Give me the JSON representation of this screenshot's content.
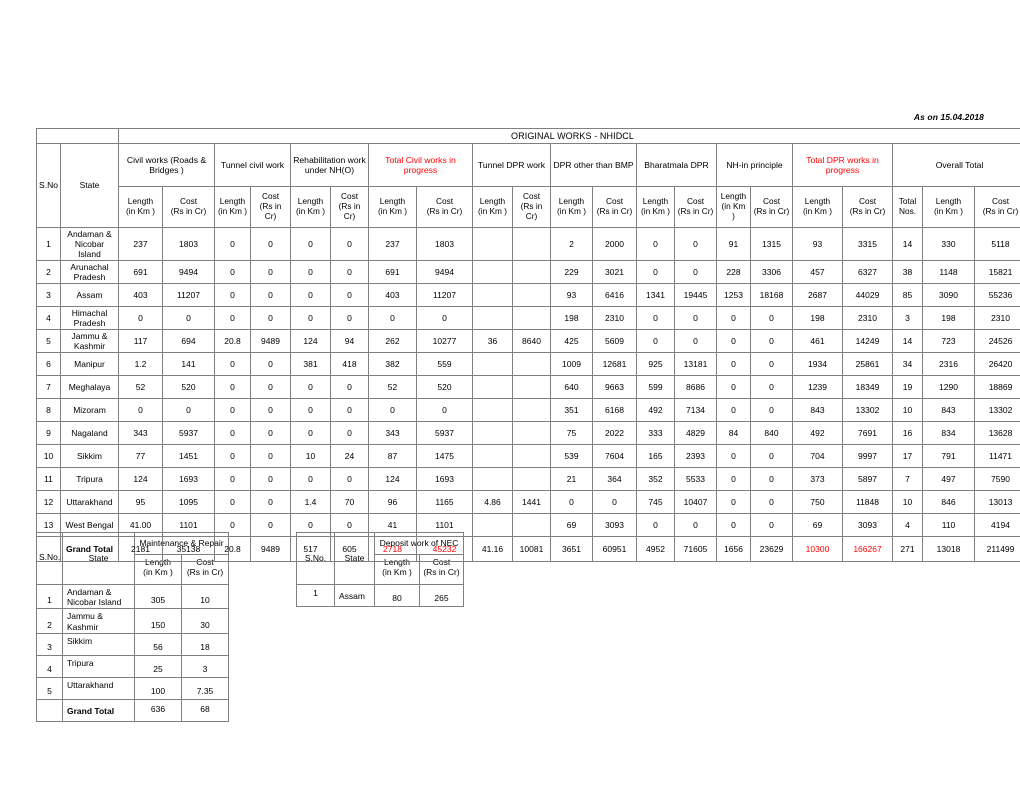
{
  "as_on": "As on 15.04.2018",
  "main_table": {
    "title": "ORIGINAL WORKS - NHIDCL",
    "sno_header": "S.No",
    "state_header": "State",
    "groups": [
      {
        "label": "Civil works (Roads & Bridges )",
        "red": false
      },
      {
        "label": "Tunnel civil work",
        "red": false
      },
      {
        "label": "Rehabilitation work under NH(O)",
        "red": false
      },
      {
        "label": "Total Civil works in progress",
        "red": true
      },
      {
        "label": "Tunnel DPR work",
        "red": false
      },
      {
        "label": "DPR other than BMP",
        "red": false
      },
      {
        "label": "Bharatmala DPR",
        "red": false
      },
      {
        "label": "NH-in principle",
        "red": false
      },
      {
        "label": "Total DPR  works in progress",
        "red": true
      },
      {
        "label": "Overall  Total",
        "red": false
      }
    ],
    "sub_headers": [
      "Length (in Km )",
      "Cost (Rs in Cr)",
      "Length (in Km )",
      "Cost (Rs in Cr)",
      "Length (in Km )",
      "Cost (Rs in Cr)",
      "Length (in Km )",
      "Cost (Rs in Cr)",
      "Length (in Km )",
      "Cost (Rs in Cr)",
      "Length (in Km )",
      "Cost (Rs in Cr)",
      "Length (in Km )",
      "Cost (Rs in Cr)",
      "Length (in Km )",
      "Cost (Rs in Cr)",
      "Length (in Km )",
      "Cost (Rs in Cr)",
      "Total Nos.",
      "Length (in Km )",
      "Cost (Rs in Cr)"
    ],
    "sub_header_parts": [
      {
        "l1": "Length",
        "l2": "(in Km )"
      },
      {
        "l1": "Cost",
        "l2": "(Rs in Cr)"
      },
      {
        "l1": "Length",
        "l2": "(in Km )"
      },
      {
        "l1": "Cost",
        "l2": "(Rs in Cr)"
      },
      {
        "l1": "Length",
        "l2": "(in Km )"
      },
      {
        "l1": "Cost",
        "l2": "(Rs in Cr)"
      },
      {
        "l1": "Length",
        "l2": "(in Km )"
      },
      {
        "l1": "Cost",
        "l2": "(Rs in Cr)"
      },
      {
        "l1": "Length",
        "l2": "(in Km )"
      },
      {
        "l1": "Cost",
        "l2": "(Rs in Cr)"
      },
      {
        "l1": "Length",
        "l2": "(in Km )"
      },
      {
        "l1": "Cost",
        "l2": "(Rs in Cr)"
      },
      {
        "l1": "Length",
        "l2": "(in Km )"
      },
      {
        "l1": "Cost",
        "l2": "(Rs in Cr)"
      },
      {
        "l1": "Length",
        "l2": "(in Km )"
      },
      {
        "l1": "Cost",
        "l2": "(Rs in Cr)"
      },
      {
        "l1": "Length",
        "l2": "(in Km )"
      },
      {
        "l1": "Cost",
        "l2": "(Rs in Cr)"
      },
      {
        "l1": "Total",
        "l2": "Nos."
      },
      {
        "l1": "Length",
        "l2": "(in Km )"
      },
      {
        "l1": "Cost",
        "l2": "(Rs in Cr)"
      }
    ],
    "rows": [
      {
        "sno": "1",
        "state": "Andaman & Nicobar Island",
        "v": [
          "237",
          "1803",
          "0",
          "0",
          "0",
          "0",
          "237",
          "1803",
          "",
          "",
          "2",
          "2000",
          "0",
          "0",
          "91",
          "1315",
          "93",
          "3315",
          "14",
          "330",
          "5118"
        ]
      },
      {
        "sno": "2",
        "state": "Arunachal Pradesh",
        "v": [
          "691",
          "9494",
          "0",
          "0",
          "0",
          "0",
          "691",
          "9494",
          "",
          "",
          "229",
          "3021",
          "0",
          "0",
          "228",
          "3306",
          "457",
          "6327",
          "38",
          "1148",
          "15821"
        ]
      },
      {
        "sno": "3",
        "state": "Assam",
        "v": [
          "403",
          "11207",
          "0",
          "0",
          "0",
          "0",
          "403",
          "11207",
          "",
          "",
          "93",
          "6416",
          "1341",
          "19445",
          "1253",
          "18168",
          "2687",
          "44029",
          "85",
          "3090",
          "55236"
        ]
      },
      {
        "sno": "4",
        "state": "Himachal Pradesh",
        "v": [
          "0",
          "0",
          "0",
          "0",
          "0",
          "0",
          "0",
          "0",
          "",
          "",
          "198",
          "2310",
          "0",
          "0",
          "0",
          "0",
          "198",
          "2310",
          "3",
          "198",
          "2310"
        ]
      },
      {
        "sno": "5",
        "state": "Jammu & Kashmir",
        "v": [
          "117",
          "694",
          "20.8",
          "9489",
          "124",
          "94",
          "262",
          "10277",
          "36",
          "8640",
          "425",
          "5609",
          "0",
          "0",
          "0",
          "0",
          "461",
          "14249",
          "14",
          "723",
          "24526"
        ]
      },
      {
        "sno": "6",
        "state": "Manipur",
        "v": [
          "1.2",
          "141",
          "0",
          "0",
          "381",
          "418",
          "382",
          "559",
          "",
          "",
          "1009",
          "12681",
          "925",
          "13181",
          "0",
          "0",
          "1934",
          "25861",
          "34",
          "2316",
          "26420"
        ]
      },
      {
        "sno": "7",
        "state": "Meghalaya",
        "v": [
          "52",
          "520",
          "0",
          "0",
          "0",
          "0",
          "52",
          "520",
          "",
          "",
          "640",
          "9663",
          "599",
          "8686",
          "0",
          "0",
          "1239",
          "18349",
          "19",
          "1290",
          "18869"
        ]
      },
      {
        "sno": "8",
        "state": "Mizoram",
        "v": [
          "0",
          "0",
          "0",
          "0",
          "0",
          "0",
          "0",
          "0",
          "",
          "",
          "351",
          "6168",
          "492",
          "7134",
          "0",
          "0",
          "843",
          "13302",
          "10",
          "843",
          "13302"
        ]
      },
      {
        "sno": "9",
        "state": "Nagaland",
        "v": [
          "343",
          "5937",
          "0",
          "0",
          "0",
          "0",
          "343",
          "5937",
          "",
          "",
          "75",
          "2022",
          "333",
          "4829",
          "84",
          "840",
          "492",
          "7691",
          "16",
          "834",
          "13628"
        ]
      },
      {
        "sno": "10",
        "state": "Sikkim",
        "v": [
          "77",
          "1451",
          "0",
          "0",
          "10",
          "24",
          "87",
          "1475",
          "",
          "",
          "539",
          "7604",
          "165",
          "2393",
          "0",
          "0",
          "704",
          "9997",
          "17",
          "791",
          "11471"
        ]
      },
      {
        "sno": "11",
        "state": "Tripura",
        "v": [
          "124",
          "1693",
          "0",
          "0",
          "0",
          "0",
          "124",
          "1693",
          "",
          "",
          "21",
          "364",
          "352",
          "5533",
          "0",
          "0",
          "373",
          "5897",
          "7",
          "497",
          "7590"
        ]
      },
      {
        "sno": "12",
        "state": "Uttarakhand",
        "v": [
          "95",
          "1095",
          "0",
          "0",
          "1.4",
          "70",
          "96",
          "1165",
          "4.86",
          "1441",
          "0",
          "0",
          "745",
          "10407",
          "0",
          "0",
          "750",
          "11848",
          "10",
          "846",
          "13013"
        ]
      },
      {
        "sno": "13",
        "state": "West Bengal",
        "v": [
          "41.00",
          "1101",
          "0",
          "0",
          "0",
          "0",
          "41",
          "1101",
          "",
          "",
          "69",
          "3093",
          "0",
          "0",
          "0",
          "0",
          "69",
          "3093",
          "4",
          "110",
          "4194"
        ]
      }
    ],
    "total_row": {
      "sno": "",
      "state": "Grand Total",
      "v": [
        "2181",
        "35138",
        "20.8",
        "9489",
        "517",
        "605",
        "2718",
        "45232",
        "41.16",
        "10081",
        "3651",
        "60951",
        "4952",
        "71605",
        "1656",
        "23629",
        "10300",
        "166267",
        "271",
        "13018",
        "211499"
      ],
      "red_indices": [
        6,
        7,
        16,
        17
      ]
    }
  },
  "maintenance_table": {
    "group_label": "Maintenance & Repair",
    "sno_header": "S.No.",
    "state_header": "State",
    "sub_headers": [
      {
        "l1": "Length",
        "l2": "(in Km )"
      },
      {
        "l1": "Cost",
        "l2": "(Rs in Cr)"
      }
    ],
    "rows": [
      {
        "sno": "1",
        "state": "Andaman & Nicobar Island",
        "length": "305",
        "cost": "10"
      },
      {
        "sno": "2",
        "state": "Jammu & Kashmir",
        "length": "150",
        "cost": "30"
      },
      {
        "sno": "3",
        "state": "Sikkim",
        "length": "56",
        "cost": "18"
      },
      {
        "sno": "4",
        "state": "Tripura",
        "length": "25",
        "cost": "3"
      },
      {
        "sno": "5",
        "state": "Uttarakhand",
        "length": "100",
        "cost": "7.35"
      }
    ],
    "total_row": {
      "sno": "",
      "state": "Grand Total",
      "length": "636",
      "cost": "68"
    }
  },
  "nec_table": {
    "group_label": "Deposit work of NEC",
    "sno_header": "S.No.",
    "state_header": "State",
    "sub_headers": [
      {
        "l1": "Length",
        "l2": "(in Km )"
      },
      {
        "l1": "Cost",
        "l2": "(Rs in Cr)"
      }
    ],
    "rows": [
      {
        "sno": "1",
        "state": "Assam",
        "length": "80",
        "cost": "265"
      }
    ]
  },
  "colors": {
    "accent_red": "#FF0000",
    "border": "#808080",
    "text": "#000000",
    "background": "#FFFFFF"
  }
}
